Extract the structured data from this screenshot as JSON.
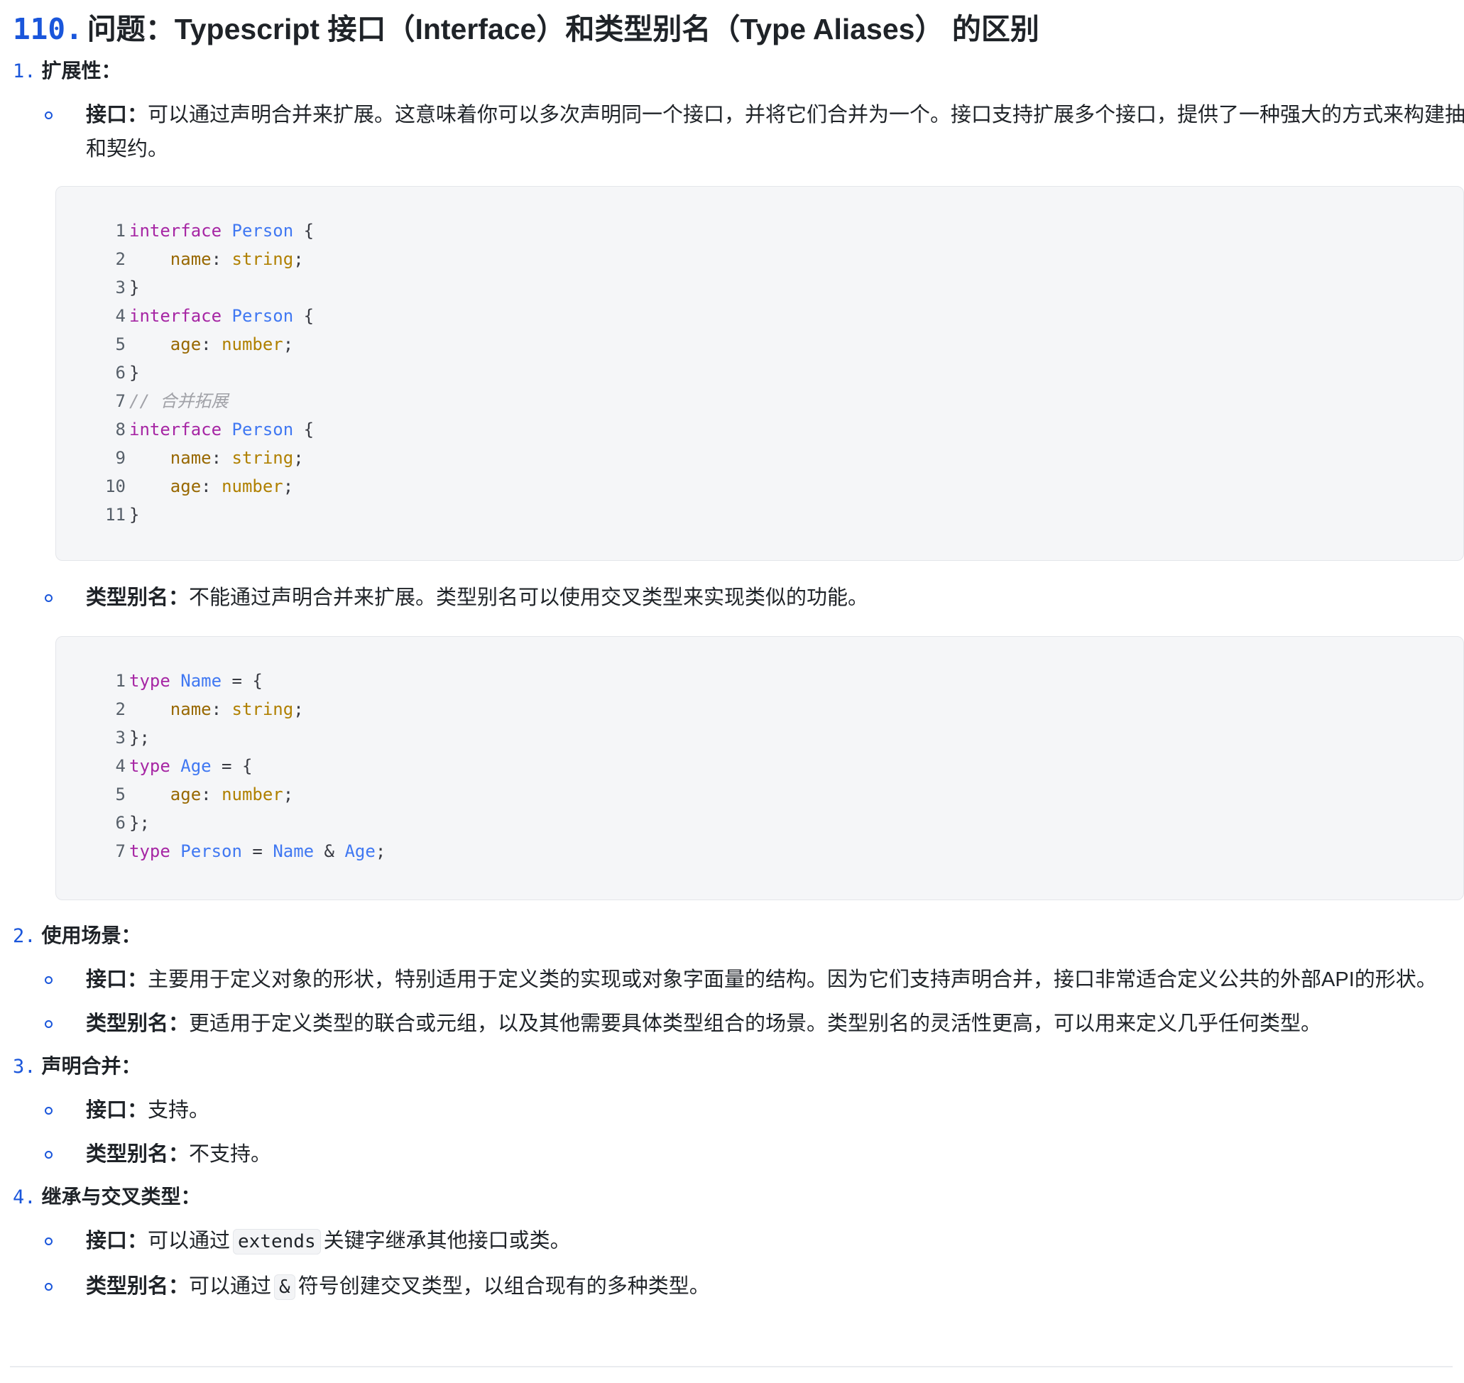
{
  "title": {
    "number": "110.",
    "text": "问题：Typescript 接口（Interface）和类型别名（Type Aliases） 的区别"
  },
  "sections": [
    {
      "marker": "1.",
      "label": "扩展性："
    },
    {
      "marker": "2.",
      "label": "使用场景："
    },
    {
      "marker": "3.",
      "label": "声明合并："
    },
    {
      "marker": "4.",
      "label": "继承与交叉类型："
    }
  ],
  "items": {
    "s1_interface": {
      "label": "接口：",
      "text": "可以通过声明合并来扩展。这意味着你可以多次声明同一个接口，并将它们合并为一个。接口支持扩展多个接口，提供了一种强大的方式来构建抽象和契约。"
    },
    "s1_alias": {
      "label": "类型别名：",
      "text": "不能通过声明合并来扩展。类型别名可以使用交叉类型来实现类似的功能。"
    },
    "s2_interface": {
      "label": "接口：",
      "text": "主要用于定义对象的形状，特别适用于定义类的实现或对象字面量的结构。因为它们支持声明合并，接口非常适合定义公共的外部API的形状。"
    },
    "s2_alias": {
      "label": "类型别名：",
      "text": "更适用于定义类型的联合或元组，以及其他需要具体类型组合的场景。类型别名的灵活性更高，可以用来定义几乎任何类型。"
    },
    "s3_interface": {
      "label": "接口：",
      "text": "支持。"
    },
    "s3_alias": {
      "label": "类型别名：",
      "text": "不支持。"
    },
    "s4_interface": {
      "label": "接口：",
      "before": "可以通过",
      "code": "extends",
      "after": "关键字继承其他接口或类。"
    },
    "s4_alias": {
      "label": "类型别名：",
      "before": "可以通过",
      "code": "&",
      "after": "符号创建交叉类型，以组合现有的多种类型。"
    }
  },
  "code_blocks": [
    {
      "lines": [
        {
          "n": "1",
          "tokens": [
            [
              "kw",
              "interface"
            ],
            [
              "pun",
              " "
            ],
            [
              "ty",
              "Person"
            ],
            [
              "pun",
              " {"
            ]
          ]
        },
        {
          "n": "2",
          "tokens": [
            [
              "pun",
              "    "
            ],
            [
              "prop",
              "name"
            ],
            [
              "pun",
              ": "
            ],
            [
              "prim",
              "string"
            ],
            [
              "pun",
              ";"
            ]
          ]
        },
        {
          "n": "3",
          "tokens": [
            [
              "pun",
              "}"
            ]
          ]
        },
        {
          "n": "4",
          "tokens": [
            [
              "kw",
              "interface"
            ],
            [
              "pun",
              " "
            ],
            [
              "ty",
              "Person"
            ],
            [
              "pun",
              " {"
            ]
          ]
        },
        {
          "n": "5",
          "tokens": [
            [
              "pun",
              "    "
            ],
            [
              "prop",
              "age"
            ],
            [
              "pun",
              ": "
            ],
            [
              "prim",
              "number"
            ],
            [
              "pun",
              ";"
            ]
          ]
        },
        {
          "n": "6",
          "tokens": [
            [
              "pun",
              "}"
            ]
          ]
        },
        {
          "n": "7",
          "tokens": [
            [
              "cm",
              "// 合并拓展"
            ]
          ]
        },
        {
          "n": "8",
          "tokens": [
            [
              "kw",
              "interface"
            ],
            [
              "pun",
              " "
            ],
            [
              "ty",
              "Person"
            ],
            [
              "pun",
              " {"
            ]
          ]
        },
        {
          "n": "9",
          "tokens": [
            [
              "pun",
              "    "
            ],
            [
              "prop",
              "name"
            ],
            [
              "pun",
              ": "
            ],
            [
              "prim",
              "string"
            ],
            [
              "pun",
              ";"
            ]
          ]
        },
        {
          "n": "10",
          "tokens": [
            [
              "pun",
              "    "
            ],
            [
              "prop",
              "age"
            ],
            [
              "pun",
              ": "
            ],
            [
              "prim",
              "number"
            ],
            [
              "pun",
              ";"
            ]
          ]
        },
        {
          "n": "11",
          "tokens": [
            [
              "pun",
              "}"
            ]
          ]
        }
      ]
    },
    {
      "lines": [
        {
          "n": "1",
          "tokens": [
            [
              "kw",
              "type"
            ],
            [
              "pun",
              " "
            ],
            [
              "ty",
              "Name"
            ],
            [
              "pun",
              " = {"
            ]
          ]
        },
        {
          "n": "2",
          "tokens": [
            [
              "pun",
              "    "
            ],
            [
              "prop",
              "name"
            ],
            [
              "pun",
              ": "
            ],
            [
              "prim",
              "string"
            ],
            [
              "pun",
              ";"
            ]
          ]
        },
        {
          "n": "3",
          "tokens": [
            [
              "pun",
              "};"
            ]
          ]
        },
        {
          "n": "4",
          "tokens": [
            [
              "kw",
              "type"
            ],
            [
              "pun",
              " "
            ],
            [
              "ty",
              "Age"
            ],
            [
              "pun",
              " = {"
            ]
          ]
        },
        {
          "n": "5",
          "tokens": [
            [
              "pun",
              "    "
            ],
            [
              "prop",
              "age"
            ],
            [
              "pun",
              ": "
            ],
            [
              "prim",
              "number"
            ],
            [
              "pun",
              ";"
            ]
          ]
        },
        {
          "n": "6",
          "tokens": [
            [
              "pun",
              "};"
            ]
          ]
        },
        {
          "n": "7",
          "tokens": [
            [
              "kw",
              "type"
            ],
            [
              "pun",
              " "
            ],
            [
              "ty",
              "Person"
            ],
            [
              "pun",
              " = "
            ],
            [
              "ty",
              "Name"
            ],
            [
              "pun",
              " & "
            ],
            [
              "ty",
              "Age"
            ],
            [
              "pun",
              ";"
            ]
          ]
        }
      ]
    }
  ]
}
